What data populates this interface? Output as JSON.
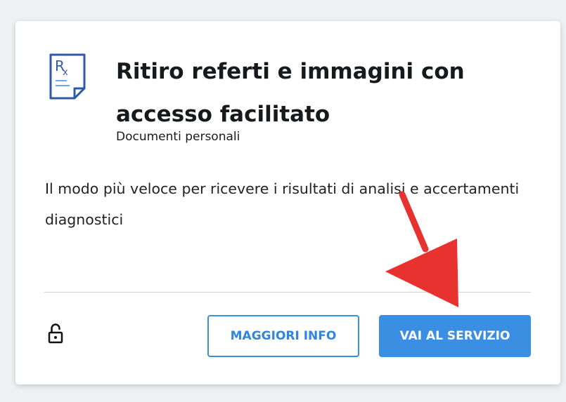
{
  "card": {
    "title": "Ritiro referti e immagini con accesso facilitato",
    "category": "Documenti personali",
    "description": "Il modo più veloce per ricevere i risultati di analisi e accertamenti diagnostici",
    "more_info_label": "MAGGIORI INFO",
    "go_to_service_label": "VAI AL SERVIZIO",
    "icon": "rx-prescription-icon",
    "lock_icon": "unlocked-padlock-icon"
  },
  "colors": {
    "accent": "#3a8fe3",
    "icon_blue": "#2d5aa8",
    "annotation_arrow": "#e8322f",
    "background": "#eef1f4"
  }
}
